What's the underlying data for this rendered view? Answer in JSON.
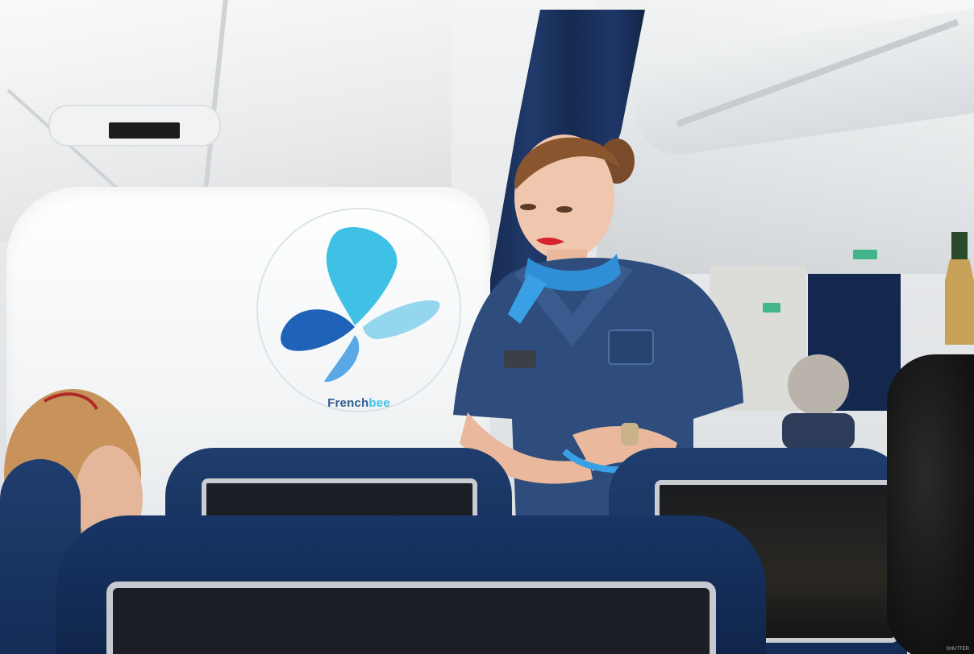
{
  "image": {
    "description_scene": "cabin",
    "brand": {
      "logo_text_part1": "French",
      "logo_text_part2": "bee",
      "colors": {
        "navy": "#2f5c8f",
        "sky": "#3fc1e6",
        "seat_blue": "#1f3d6e",
        "curtain": "#162a4f",
        "lipstick": "#d6232f",
        "scarf": "#2f8fd6"
      }
    },
    "credit": "SHUTTER"
  }
}
